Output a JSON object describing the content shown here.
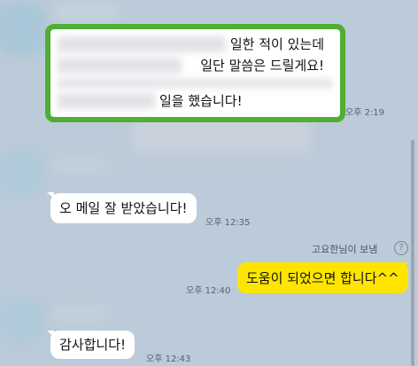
{
  "messages": [
    {
      "line1": "일한 적이 있는데",
      "line2": "일단 말씀은 드릴게요!",
      "line3": "일을 했습니다!",
      "time": "오후 2:19"
    },
    {
      "text": "오 메일 잘 받았습니다!",
      "time": "오후 12:35"
    },
    {
      "sender_note": "고요한님이 보냄",
      "help": "?",
      "text": "도움이 되었으면 합니다^^",
      "time": "오후 12:40"
    },
    {
      "text": "감사합니다!",
      "time": "오후 12:43"
    }
  ],
  "colors": {
    "background": "#bccbd9",
    "highlight": "#4fae33",
    "my_bubble": "#fee500"
  }
}
